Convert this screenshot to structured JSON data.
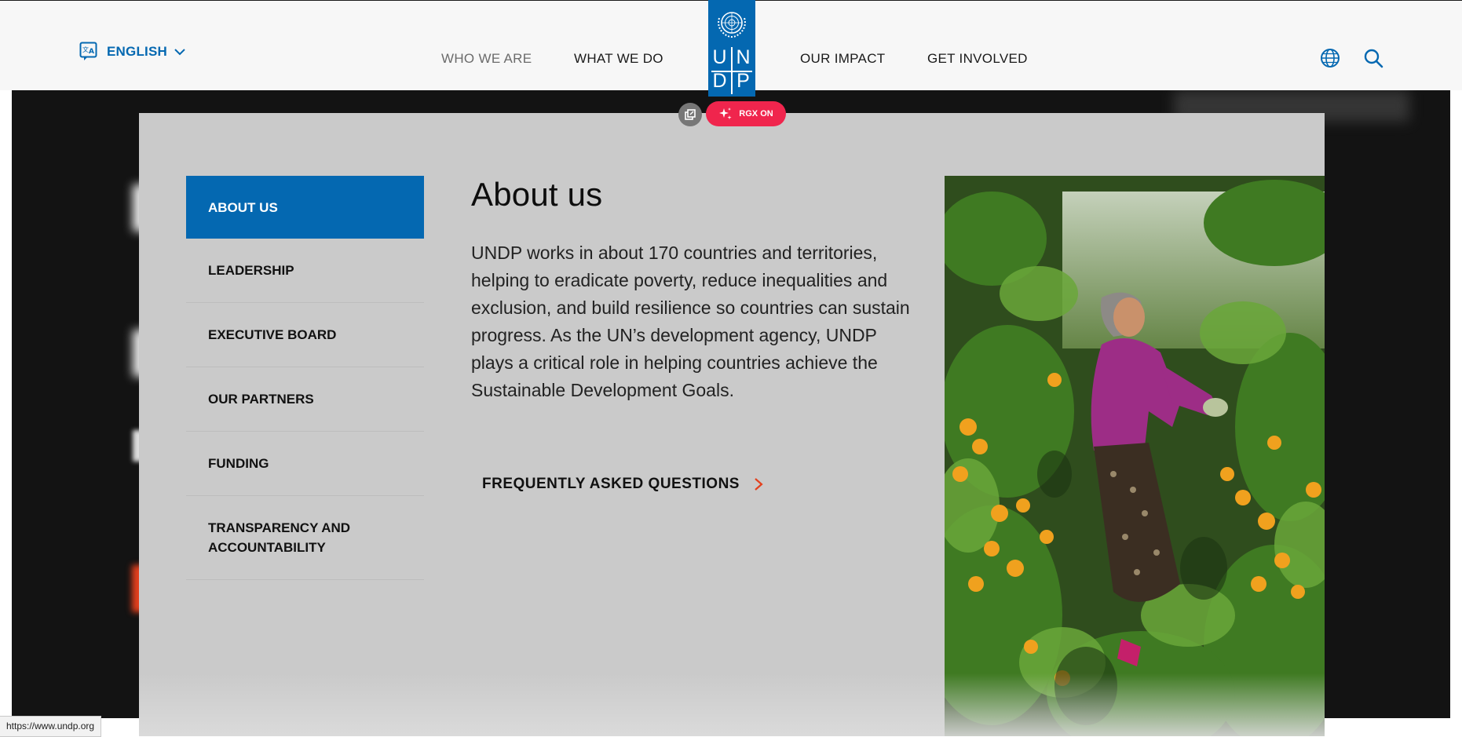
{
  "header": {
    "language_label": "ENGLISH",
    "nav": [
      "WHO WE ARE",
      "WHAT WE DO",
      "OUR IMPACT",
      "GET INVOLVED"
    ],
    "logo_letters": [
      "U",
      "N",
      "D",
      "P"
    ]
  },
  "tools": {
    "rgx_label": "RGX ON"
  },
  "menu": {
    "items": [
      "ABOUT US",
      "LEADERSHIP",
      "EXECUTIVE BOARD",
      "OUR PARTNERS",
      "FUNDING",
      "TRANSPARENCY AND ACCOUNTABILITY"
    ],
    "active_index": 0,
    "title": "About us",
    "body": "UNDP works in about 170 countries and territories, helping to eradicate poverty, reduce inequalities and exclusion, and build resilience so countries can sustain progress. As the UN’s development agency, UNDP plays a critical role in helping countries achieve the Sustainable Development Goals.",
    "link_label": "FREQUENTLY ASKED QUESTIONS"
  },
  "status_bar": {
    "url": "https://www.undp.org"
  },
  "colors": {
    "brand_blue": "#0468b1",
    "accent_red": "#e3401d",
    "rgx_pink": "#f0254d",
    "panel_gray": "#cacaca"
  }
}
